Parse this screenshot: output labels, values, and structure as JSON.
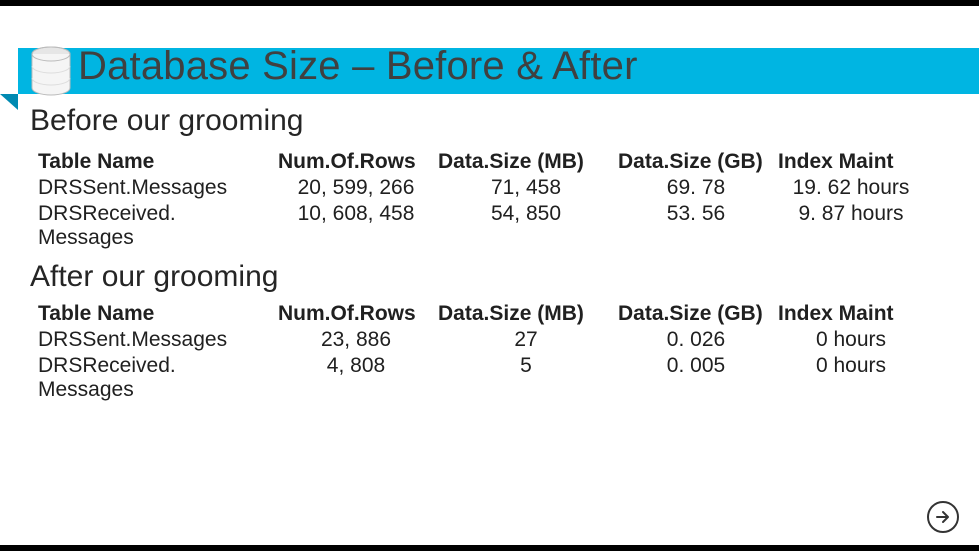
{
  "title": "Database Size – Before & After",
  "sections": {
    "before": {
      "label": "Before our grooming",
      "headers": [
        "Table Name",
        "Num.Of.Rows",
        "Data.Size (MB)",
        "Data.Size (GB)",
        "Index Maint"
      ],
      "rows": [
        {
          "name": "DRSSent.Messages",
          "rows": "20, 599, 266",
          "mb": "71, 458",
          "gb": "69. 78",
          "idx": "19. 62 hours"
        },
        {
          "name": "DRSReceived. Messages",
          "rows": "10, 608, 458",
          "mb": "54, 850",
          "gb": "53. 56",
          "idx": "9. 87 hours"
        }
      ]
    },
    "after": {
      "label": "After our grooming",
      "headers": [
        "Table Name",
        "Num.Of.Rows",
        "Data.Size (MB)",
        "Data.Size (GB)",
        "Index Maint"
      ],
      "rows": [
        {
          "name": "DRSSent.Messages",
          "rows": "23, 886",
          "mb": "27",
          "gb": "0. 026",
          "idx": "0 hours"
        },
        {
          "name": "DRSReceived. Messages",
          "rows": "4, 808",
          "mb": "5",
          "gb": "0. 005",
          "idx": "0 hours"
        }
      ]
    }
  },
  "icons": {
    "database": "database-icon",
    "next": "next-icon"
  },
  "chart_data": {
    "type": "table",
    "title": "Database Size – Before & After",
    "tables": [
      {
        "name": "Before our grooming",
        "columns": [
          "Table Name",
          "Num.Of.Rows",
          "Data.Size (MB)",
          "Data.Size (GB)",
          "Index Maint"
        ],
        "rows": [
          [
            "DRSSent.Messages",
            20599266,
            71458,
            69.78,
            "19.62 hours"
          ],
          [
            "DRSReceived.Messages",
            10608458,
            54850,
            53.56,
            "9.87 hours"
          ]
        ]
      },
      {
        "name": "After our grooming",
        "columns": [
          "Table Name",
          "Num.Of.Rows",
          "Data.Size (MB)",
          "Data.Size (GB)",
          "Index Maint"
        ],
        "rows": [
          [
            "DRSSent.Messages",
            23886,
            27,
            0.026,
            "0 hours"
          ],
          [
            "DRSReceived.Messages",
            4808,
            5,
            0.005,
            "0 hours"
          ]
        ]
      }
    ]
  }
}
